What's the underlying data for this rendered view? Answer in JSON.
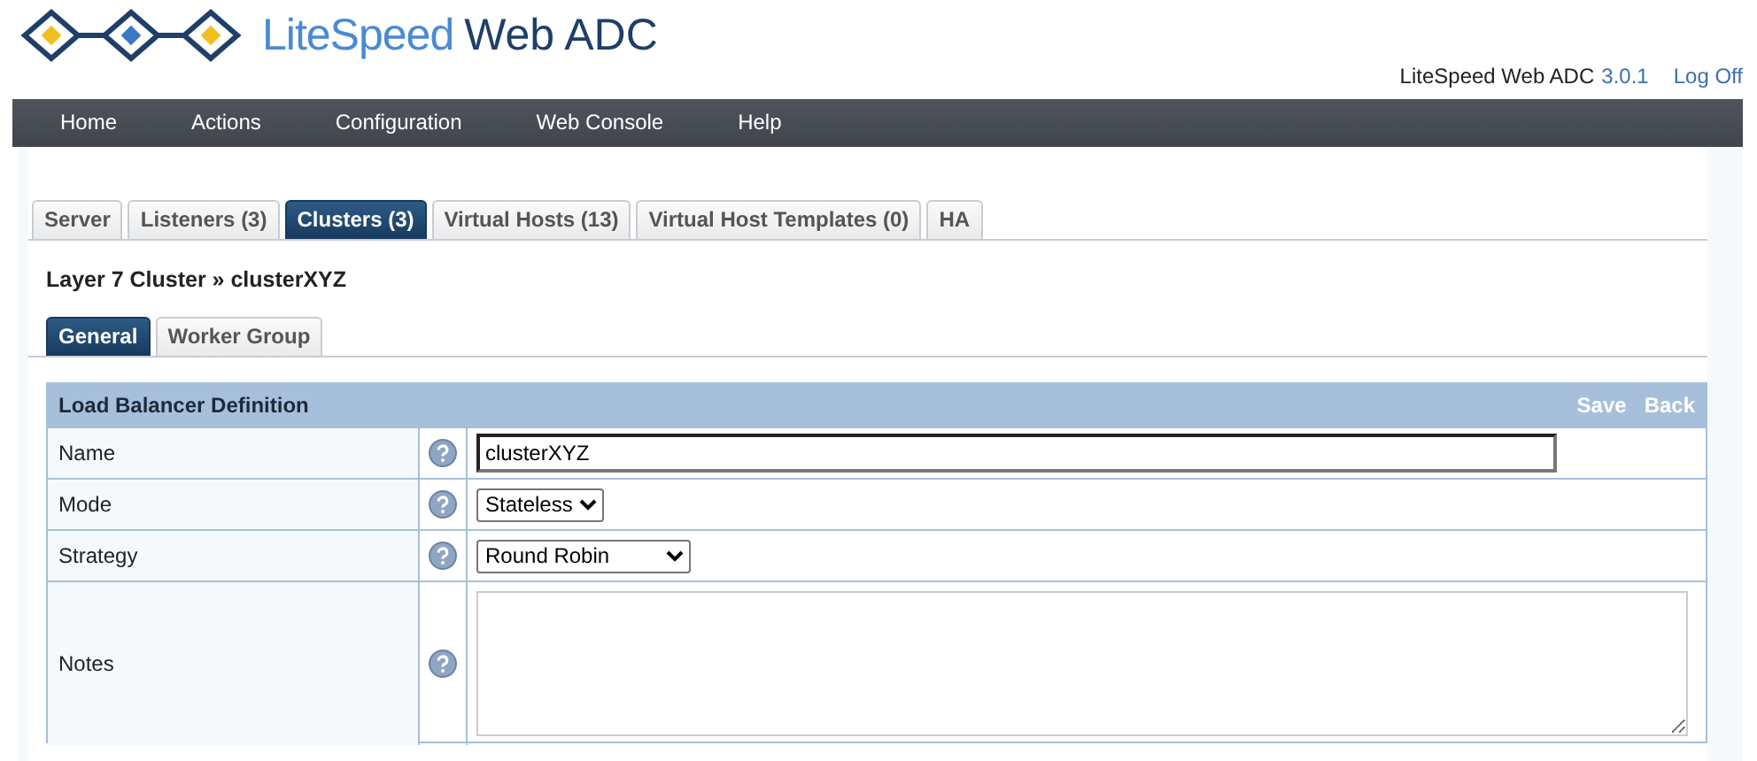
{
  "header": {
    "logo_light": "LiteSpeed",
    "logo_dark": "Web ADC",
    "product": "LiteSpeed Web ADC",
    "version": "3.0.1",
    "logoff": "Log Off"
  },
  "nav": [
    "Home",
    "Actions",
    "Configuration",
    "Web Console",
    "Help"
  ],
  "tabs": [
    {
      "label": "Server",
      "selected": false
    },
    {
      "label": "Listeners (3)",
      "selected": false
    },
    {
      "label": "Clusters (3)",
      "selected": true
    },
    {
      "label": "Virtual Hosts (13)",
      "selected": false
    },
    {
      "label": "Virtual Host Templates (0)",
      "selected": false
    },
    {
      "label": "HA",
      "selected": false
    }
  ],
  "breadcrumb": "Layer 7 Cluster » clusterXYZ",
  "subtabs": [
    {
      "label": "General",
      "selected": true
    },
    {
      "label": "Worker Group",
      "selected": false
    }
  ],
  "section": {
    "title": "Load Balancer Definition",
    "actions": [
      "Save",
      "Back"
    ],
    "rows": [
      {
        "label": "Name",
        "kind": "text",
        "value": "clusterXYZ"
      },
      {
        "label": "Mode",
        "kind": "select",
        "value": "Stateless"
      },
      {
        "label": "Strategy",
        "kind": "select",
        "value": "Round Robin"
      },
      {
        "label": "Notes",
        "kind": "textarea"
      }
    ]
  }
}
